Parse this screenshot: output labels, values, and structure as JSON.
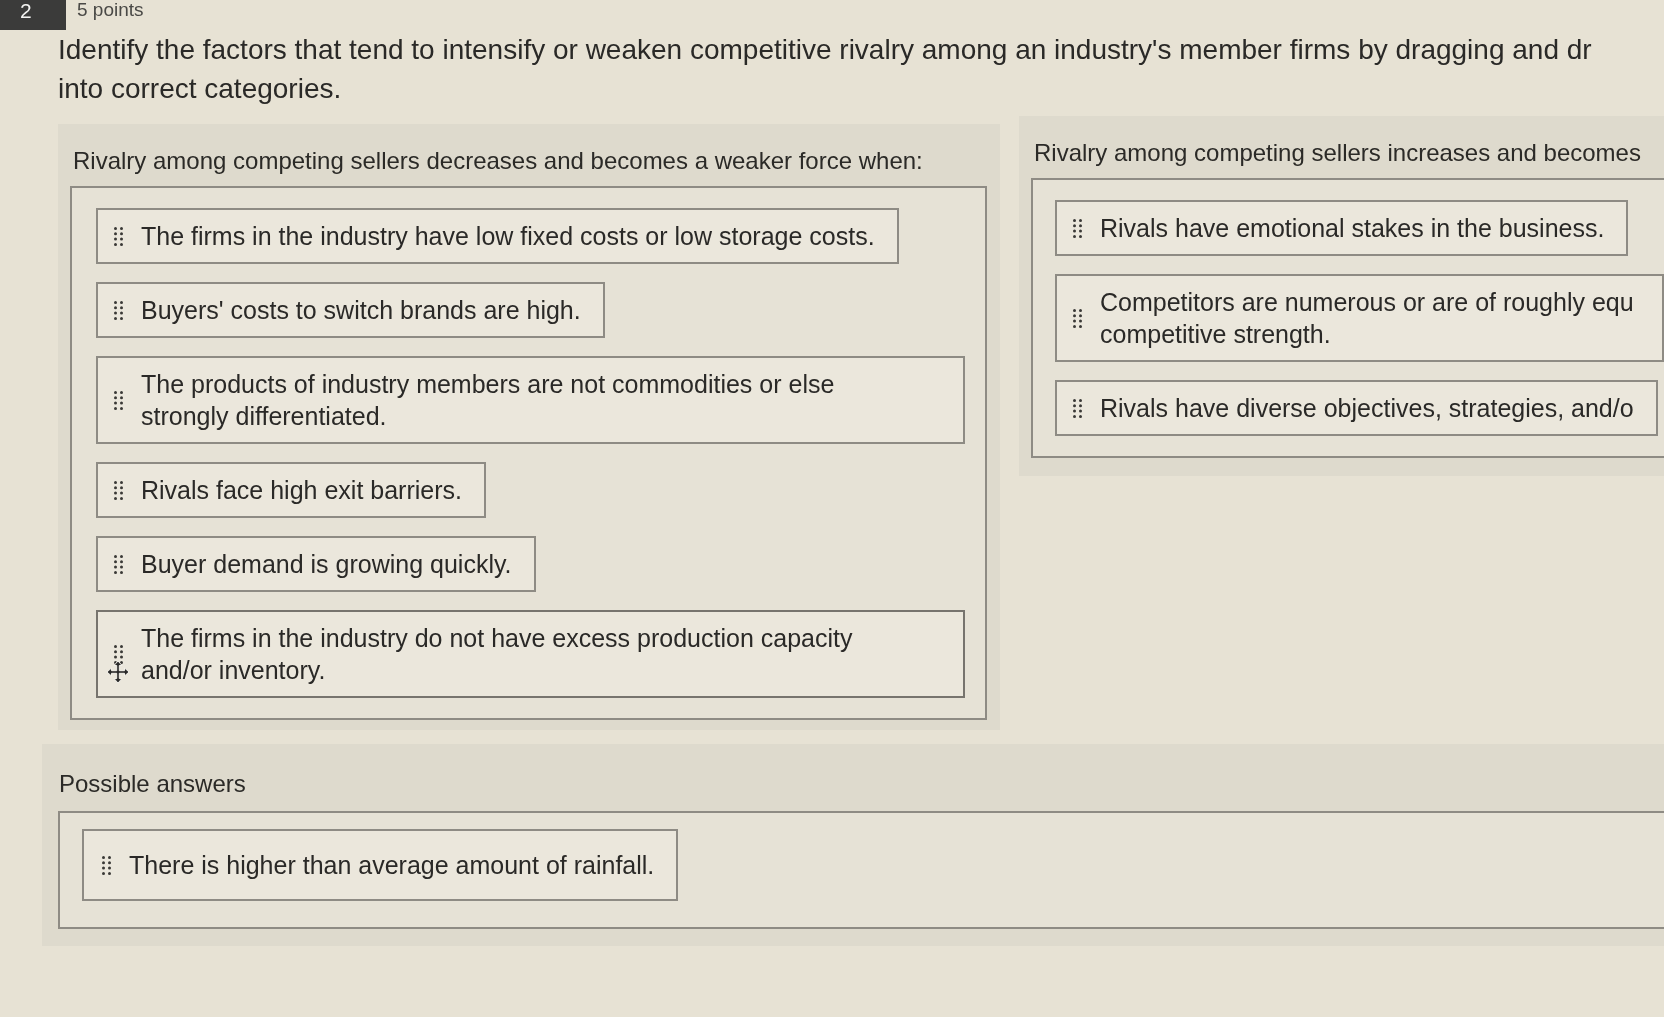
{
  "question": {
    "number": "2",
    "points": "5 points",
    "prompt_lines": [
      "Identify the factors that tend to intensify or weaken competitive rivalry among an industry's member firms by dragging and dr",
      "into correct categories."
    ]
  },
  "categories": [
    {
      "title": "Rivalry among competing sellers decreases and becomes a weaker force when:",
      "items": [
        {
          "lines": [
            "The firms in the industry have low fixed costs or low storage costs."
          ],
          "hovered": false
        },
        {
          "lines": [
            "Buyers' costs to switch brands are high."
          ],
          "hovered": false
        },
        {
          "lines": [
            "The products of industry members are not commodities or else",
            "strongly differentiated."
          ],
          "hovered": false
        },
        {
          "lines": [
            "Rivals face high exit barriers."
          ],
          "hovered": false
        },
        {
          "lines": [
            "Buyer demand is growing quickly."
          ],
          "hovered": false
        },
        {
          "lines": [
            "The firms in the industry do not have excess production capacity",
            "and/or inventory."
          ],
          "hovered": true
        }
      ]
    },
    {
      "title": "Rivalry among competing sellers increases and becomes",
      "items": [
        {
          "lines": [
            "Rivals have emotional stakes in the business."
          ],
          "hovered": false
        },
        {
          "lines": [
            "Competitors are numerous or are of roughly equ",
            "competitive strength."
          ],
          "hovered": false
        },
        {
          "lines": [
            "Rivals have diverse objectives, strategies, and/o"
          ],
          "hovered": false
        }
      ]
    }
  ],
  "possible_answers": {
    "title": "Possible answers",
    "items": [
      {
        "lines": [
          "There is higher than average amount of rainfall."
        ],
        "hovered": false
      }
    ]
  }
}
